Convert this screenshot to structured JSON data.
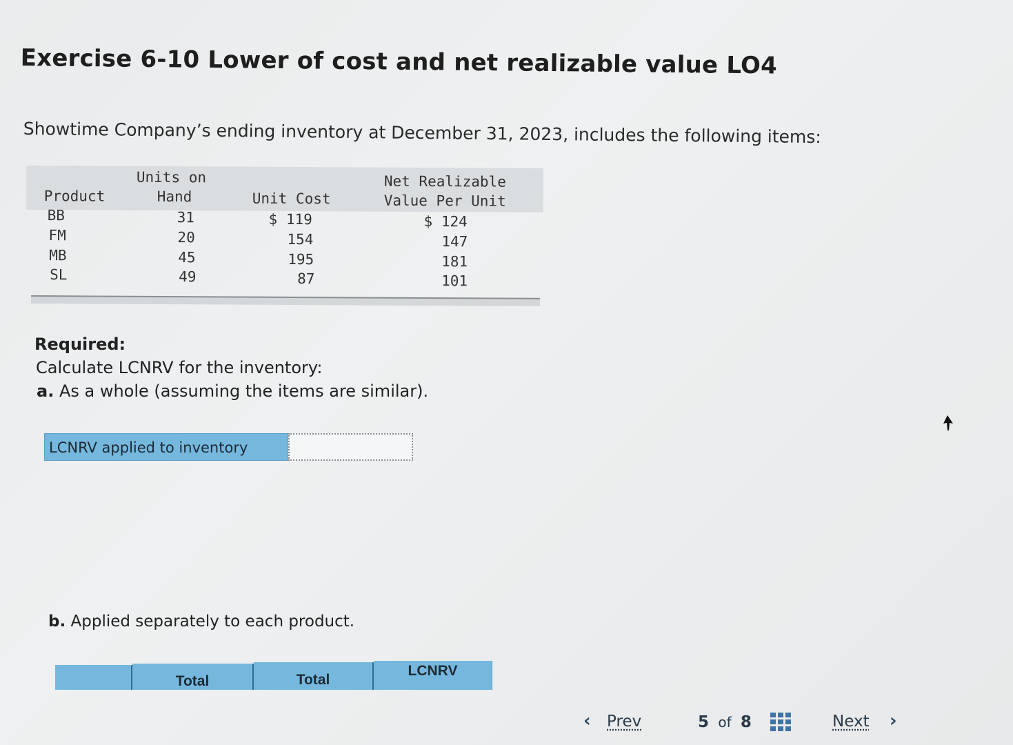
{
  "title": "Exercise 6-10 Lower of cost and net realizable value LO4",
  "intro": "Showtime Company’s ending inventory at December 31, 2023, includes the following items:",
  "inventory_table": {
    "headers": {
      "product": "Product",
      "units_line1": "Units on",
      "units_line2": "Hand",
      "cost": "Unit Cost",
      "nrv_line1": "Net Realizable",
      "nrv_line2": "Value Per Unit"
    },
    "rows": [
      {
        "product": "BB",
        "units": "31",
        "cost": "$ 119",
        "nrv": "$ 124"
      },
      {
        "product": "FM",
        "units": "20",
        "cost": "154",
        "nrv": "147"
      },
      {
        "product": "MB",
        "units": "45",
        "cost": "195",
        "nrv": "181"
      },
      {
        "product": "SL",
        "units": "49",
        "cost": "87",
        "nrv": "101"
      }
    ]
  },
  "required": {
    "label": "Required:",
    "instruction": "Calculate LCNRV for the inventory:",
    "part_a_letter": "a.",
    "part_a_text": " As a whole (assuming the items are similar)."
  },
  "lcnrv_row": {
    "label": "LCNRV applied to inventory",
    "value": ""
  },
  "part_b": {
    "letter": "b.",
    "text": " Applied separately to each product."
  },
  "part_b_table": {
    "headers": [
      "Total",
      "Total",
      "LCNRV"
    ]
  },
  "footer": {
    "prev_label": "Prev",
    "page_current": "5",
    "page_of": "of",
    "page_total": "8",
    "next_label": "Next"
  },
  "colors": {
    "header_blue": "#76b8dd",
    "nav_text": "#2b3a48",
    "grid_icon": "#3e73a8"
  }
}
